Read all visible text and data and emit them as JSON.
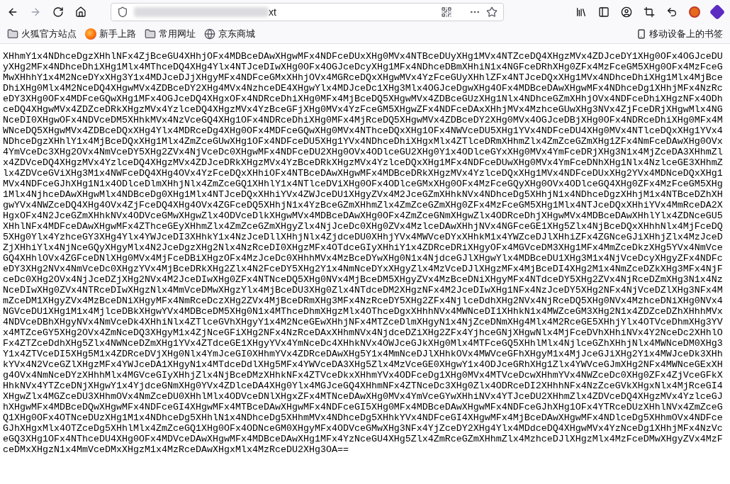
{
  "address_bar": {
    "url_visible": "xt"
  },
  "bookmarks": [
    {
      "label": "火狐官方站点",
      "kind": "folder"
    },
    {
      "label": "新手上路",
      "kind": "firefox"
    },
    {
      "label": "常用网址",
      "kind": "folder"
    },
    {
      "label": "京东商城",
      "kind": "site"
    }
  ],
  "mobile_bookmarks": {
    "label": "移动设备上的书签"
  },
  "page": {
    "text": "XHhmY1x4NDhceDgzXHhlNFx4ZjBceGU4XHhjOFx4MDBceDAwXHgwMFx4NDFceDUxXHg0MVx4NTBceDUyXHg1MVx4NTZceDQ4XHgzMVx4ZDJceDY1XHg0OFx4OGJceDUyXHg2MFx4NDhceDhiXHg1Mlx4MThceDQ4XHg4Ylx4NTJceDIwXHg0OFx4OGJceDcyXHg1MFx4NDhceDBmXHhiN1x4NGFceDRhXHg0ZFx4MzFceGM5XHg0OFx4MzFceGMwXHhhY1x4M2NceDYxXHg3Y1x4MDJceDJjXHgyMFx4NDFceGMxXHhjOVx4MGRceDQxXHgwMVx4YzFceGUyXHhlZFx4NTJceDQxXHg1MVx4NDhceDhiXHg1Mlx4MjBceDhiXHg0Mlx4M2NceDQ4XHgwMVx4ZDBceDY2XHg4MVx4NzhceDE4XHgwYlx4MDJceDc1XHg3Mlx4OGJceDgwXHg4OFx4MDBceDAwXHgwMFx4NDhceDg1XHhjMFx4NzRceDY3XHg0OFx4MDFceGQwXHg1MFx4OGJceDQ4XHgxOFx4NDRceDhiXHg0MFx4MjBceDQ5XHgwMVx4ZDBceGUzXHg1Nlx4NDhceGZmXHhjOVx4NDFceDhiXHgzNFx4ODhceDQ4XHgwMVx4ZDZceDRkXHgzMVx4YzlceDQ4XHgzMVx4YzBceGFjXHg0MVx4YzFceGM5XHgwZFx4NDFceDAxXHhjMVx4MzhceGUwXHg3NVx4ZjFceDRjXHgwMlx4NGNceDI0XHgwOFx4NDVceDM5XHhkMVx4NzVceGQ4XHg1OFx4NDRceDhiXHg0MFx4MjRceDQ5XHgwMVx4ZDBceDY2XHg0MVx4OGJceDBjXHg0OFx4NDRceDhiXHg0MFx4MWNceDQ5XHgwMVx4ZDBceDQxXHg4Ylx4MDRceDg4XHg0OFx4MDFceGQwXHg0MVx4NThceDQxXHg1OFx4NWVceDU5XHg1YVx4NDFceDU4XHg0MVx4NTlceDQxXHg1YVx4NDhceDgzXHhlY1x4MjBceDQxXHg1Mlx4ZmZceGUwXHg1OFx4NDFceDU5XHg1YVx4NDhceDhiXHgxMlx4ZTlceDRmXHhmZlx4ZmZceGZmXHg1ZFx4NmFceDAwXHg0OVx4YmVceDc3XHg2OVx4NmVceDY5XHg2ZVx4NjVceDc0XHgwMFx4NDFceDU2XHg0OVx4ODlceGU2XHg0Y1x4ODlceGYxXHg0MVx4YmFceDRjXHg3N1x4MjZceDA3XHhmZlx4ZDVceDQ4XHgzMVx4YzlceDQ4XHgzMVx4ZDJceDRkXHgzMVx4YzBceDRkXHgzMVx4YzlceDQxXHg1MFx4NDFceDUwXHg0MVx4YmFceDNhXHg1Nlx4NzlceGE3XHhmZlx4ZDVceGViXHg3M1x4NWFceDQ4XHg4OVx4YzFceDQxXHhiOFx4NTBceDAwXHgwMFx4MDBceDRkXHgzMVx4YzlceDQxXHg1MVx4NDFceDUxXHg2YVx4MDNceDQxXHg1MVx4NDFceGJhXHg1N1x4ODlceDlmXHhjNlx4ZmZceGQ1XHhlY1x4NTlceDViXHg0OFx4ODlceGMxXHg0OFx4MzFceGQyXHg0OVx4ODlceGQ4XHg0ZFx4MzFceGM5XHg1Mlx4NjhceDAwXHgwMlx4NDBceDg0XHg1Mlx4NTJceDQxXHhiYVx4ZWJceDU1XHgyZVx4M2JceGZmXHhkNVx4NDhceDg5XHhjN1x4NDhceDgzXHhjM1x4NTBceDZhXHgwYVx4NWZceDQ4XHg4OVx4ZjFceDQ4XHg4OVx4ZGFceDQ5XHhjN1x4YzBceGZmXHhmZlx4ZmZceGZmXHg0ZFx4MzFceGM5XHg1Mlx4NTJceDQxXHhiYVx4MmRceDA2XHgxOFx4N2JceGZmXHhkNVx4ODVceGMwXHgwZlx4ODVceDlkXHgwMVx4MDBceDAwXHg0OFx4ZmZceGNmXHgwZlx4ODRceDhjXHgwMVx4MDBceDAwXHhlYlx4ZDNceGU5XHhlNFx4MDFceDAwXHgwMFx4ZThceGEyXHhmZlx4ZmZceGZmXHgyZlx4NjJceDc0XHg0ZVx4MzlceDAwXHhjNVx4NGFceGE1XHg5Zlx4NjBceDQxXHhhNlx4MjFceDQ5XHg0Ylx4YzhceGY3XHg4Ylx4YWJceDI3XHhkY1x4NzJceDllXHhjNlx4ZjdceDU0XHhjYVx4MWVceDYxXHhkM1x4YWZceDJlXHhiZFx4ZGNceGJiXHhjZlx4MzJceDZjXHhiYlx4NjNceGQyXHgyMlx4N2JceDgzXHg2Nlx4NzRceDI0XHgzMFx4OTdceGIyXHhiY1x4ZDRceDRiXHgyOFx4MGVceDM3XHg1MFx4MmZceDkzXHg5YVx4NmVceGQ4XHhlOVx4ZGFceDNlXHg0MVx4MjFceDBiXHgzOFx4MzJceDc0XHhhMVx4MzBceDYwXHg0N1x4NjdceGJlXHgwYlx4MDBceDU1XHg3M1x4NjVceDcyXHgyZFx4NDFceDY3XHg2NVx4NmVceDc0XHgzYVx4MjBceDRkXHg2Zlx4N2FceDY5XHg2Y1x4NmNceDYxXHgyZlx4MzVceDJlXHgzMFx4MjBceDI4XHg2M1x4NmZceDZkXHg3MFx4NjFceDc0XHg2OVx4NjJceDZjXHg2NVx4M2JceDIwXHg0ZFx4NTNceDQ5XHg0NVx4MjBceDM5XHgyZVx4MzBceDNiXHgyMFx4NTdceDY5XHg2ZVx4NjRceDZmXHg3N1x4NzNceDIwXHg0ZVx4NTRceDIwXHgzNlx4MmVceDMwXHgzYlx4MjBceDU3XHg0Zlx4NTdceDM2XHgzNFx4M2JceDIwXHg1NFx4NzJceDY5XHg2NFx4NjVceDZlXHg3NFx4MmZceDM1XHgyZVx4MzBceDNiXHgyMFx4NmRceDczXHg2ZVx4MjBceDRmXHg3MFx4NzRceDY5XHg2ZFx4NjlceDdhXHg2NVx4NjRceDQ5XHg0NVx4MzhceDNiXHg0NVx4NGVceDU1XHg1M1x4MjlceDBkXHgwYVx4MDBceDM5XHg0N1x4MThceDhmXHgzMlx4OThceDgxXHhhNVx4MWNceDI1XHhkN1x4MWZceGM3XHg2N1x4ZDZceDZhXHhhMVx4NDVceDBhXHgyNVx4NmVceDk4XHhiNlx4ZTlceGVhXHgyY1x4M2NceGEwXHhjNFx4MTZceDlmXHgyN1x4NjZceDNmXHg4Mlx4M2RceGE5XHhjYlx4OTVceDhmXHg3YVx4MTZceGY5XHg2OVx4ZmNceDQ3XHgyM1x4ZjNceGFiXHg2NFx4NzRceDAxXHhmNVx4NjdceDZiXHg2ZFx4YjhceGNjXHgwNlx4MjFceDVhXHhiNVx4Y2NceDc2XHhlOFx4ZTZceDdhXHg5Zlx4NWNceDZmXHg1YVx4ZTdceGE1XHgyYVx4YmNceDc4XHhkNVx4OWJceGJkXHg0Mlx4MTFceGQ5XHhlMlx4NjlceGZhXHhjNlx4MWNceDM0XHg3Y1x4ZTVceDI5XHg5M1x4ZDRceDVjXHg0Nlx4YmJceGI0XHhmYVx4ZDRceDAwXHg5Y1x4MmNceDJlXHhkOVx4MWVceGFhXHgyM1x4MjJceGJiXHg2Y1x4MWJceDk3XHhkYVx4N2VceGZlXHgzMFx4YWJceDA1XHgyN1x4MTdceDdlXHg5MFx4YWVceDA3XHg5Zlx4MzVceGE0XHgwY1x4ODJceGRhXHg1Zlx4YWVceGJmXHg2NFx4MWNceGExXHg4OVx4NmNceDYzXHhhMlx4MGVceGIyXHhjZlx4NjBceDMzXHhkNFx4ZTVceDkxXHhmYVx4ODFceDg1XHg0MVx4MTVceDcwXHhmYVx4NWZceDc0XHg0ZFx4ZjVceGFkXHhkNVx4YTZceDNjXHgwY1x4YjdceGNmXHg0YVx4ZDlceDA4XHg0Ylx4MGJceGQ4XHhmNFx4ZTNceDc3XHg0Zlx4ODRceDI2XHhhNFx4NzZceGVkXHgxNlx4MjRceGI4XHgwZlx4MGZceDU3XHhmOVx4NmZceDU0XHhlMlx4ODVceDNlXHgxZFx4MTNceDAwXHg0MVx4YmVceGYwXHhiNVx4YTJceDU2XHhmZlx4ZDVceDQ4XHgzMVx4YzlceGJhXHgwMFx4MDBceDQwXHgwMFx4NDFceGI4XHgwMFx4MTBceDAwXHgwMFx4NDFceGI5XHg0MFx4MDBceDAwXHgwMFx4NDFceGJhXHg1OFx4YTRceDUzXHhlNVx4ZmZceGQ1XHg0OFx4OTNceDUzXHg1M1x4NDhceDg5XHhlN1x4NDhceDg5XHhmMVx4NDhceDg5XHhkYVx4NDFceGI4XHgwMFx4MjBceDAwXHgwMFx4NDlceDg5XHhmOVx4NDFceGJhXHgxMlx4OTZceDg5XHhlMlx4ZmZceGQ1XHg0OFx4ODNceGM0XHgyMFx4ODVceGMwXHg3NFx4YjZceDY2XHg4Ylx4MDdceDQ4XHgwMVx4YzNceDg1XHhjMFx4NzVceGQ3XHg1OFx4NThceDU4XHg0OFx4MDVceDAwXHgwMFx4MDBceDAwXHg1MFx4YzNceGU4XHg5Zlx4ZmRceGZmXHhmZlx4MzhceDJlXHgzMlx4MzFceDMwXHgyZVx4MzFceDMxXHgzN1x4MmVceDMxXHgzM1x4MzRceDAwXHgxMlx4MzRceDU2XHg3OA=="
  }
}
